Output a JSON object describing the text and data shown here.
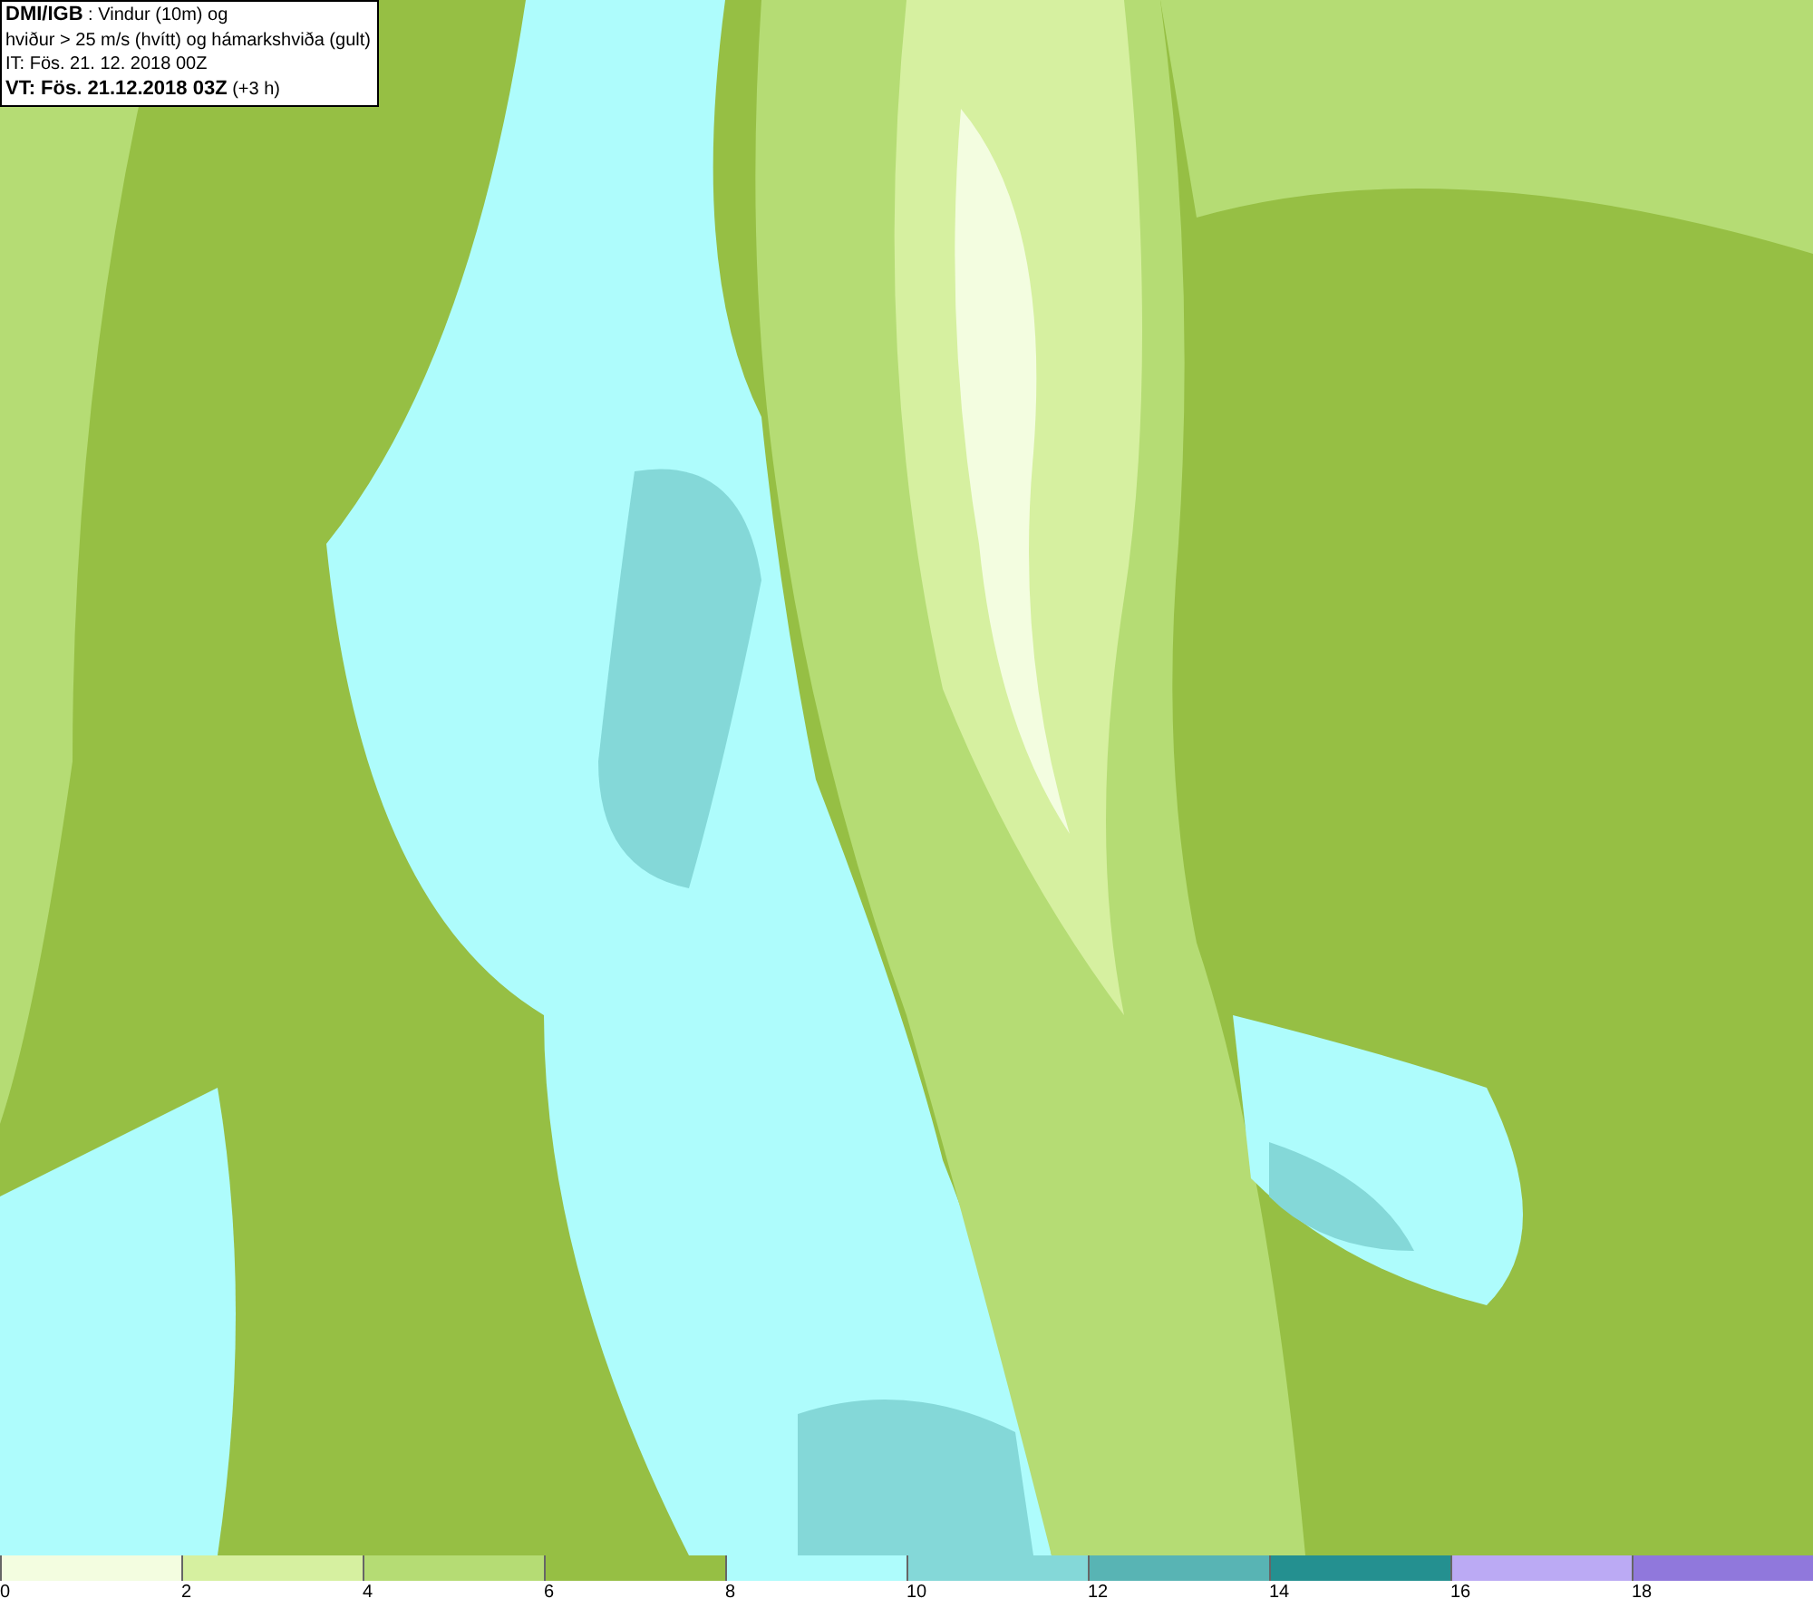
{
  "header": {
    "lines": [
      "**DMI/IGB** : Vindur (10m) og",
      "hviður > 25 m/s (hvítt) og hámarkshviða (gult)",
      "IT: Fös. 21. 12. 2018 00Z",
      "**VT: Fös. 21.12.2018 03Z** (+3 h)"
    ]
  },
  "legend": [
    {
      "label": "0",
      "color": "#f3fde0"
    },
    {
      "label": "2",
      "color": "#d6f0a0"
    },
    {
      "label": "4",
      "color": "#b5dc74"
    },
    {
      "label": "6",
      "color": "#96bf44"
    },
    {
      "label": "8",
      "color": "#aefcfc"
    },
    {
      "label": "10",
      "color": "#84d8d8"
    },
    {
      "label": "12",
      "color": "#58b4b4"
    },
    {
      "label": "14",
      "color": "#249090"
    },
    {
      "label": "16",
      "color": "#bbaaf4"
    },
    {
      "label": "18",
      "color": "#9078dc"
    }
  ]
}
